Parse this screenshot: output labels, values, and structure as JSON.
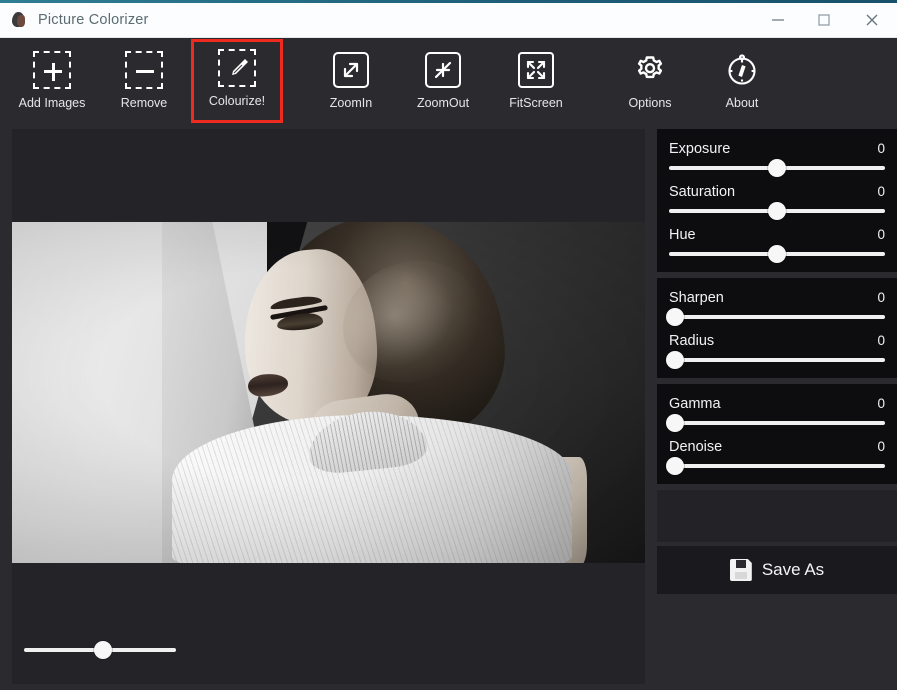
{
  "window": {
    "title": "Picture Colorizer",
    "icon": "app-logo-icon",
    "accent_top_color": "#2e7e95",
    "titlebar_bg": "#fbfdfe",
    "controls": {
      "minimize_label": "–",
      "maximize_label": "□",
      "close_label": "✕"
    }
  },
  "toolbar": {
    "background": "#2b2b2f",
    "highlight_color": "#ef2b20",
    "items": [
      {
        "label": "Add Images",
        "icon": "dashed-square-plus-icon",
        "highlighted": false
      },
      {
        "label": "Remove",
        "icon": "dashed-square-minus-icon",
        "highlighted": false
      },
      {
        "label": "Colourize!",
        "icon": "dashed-square-eyedropper-icon",
        "highlighted": true
      },
      {
        "label": "ZoomIn",
        "icon": "zoom-in-arrows-icon",
        "highlighted": false
      },
      {
        "label": "ZoomOut",
        "icon": "zoom-out-arrows-icon",
        "highlighted": false
      },
      {
        "label": "FitScreen",
        "icon": "fit-screen-arrows-icon",
        "highlighted": false
      },
      {
        "label": "Options",
        "icon": "gear-icon",
        "highlighted": false
      },
      {
        "label": "About",
        "icon": "compass-icon",
        "highlighted": false
      }
    ]
  },
  "canvas": {
    "background": "#242428",
    "image_description": "Black and white vintage portrait photograph of a woman in profile with a short bob hairstyle wearing a white ribbed sleeveless turtleneck top",
    "zoom_slider": {
      "name": "zoom-slider",
      "value_percent": 52
    }
  },
  "sidebar": {
    "background": "#2b2b2f",
    "group_background": "#0d0d10",
    "groups": [
      {
        "sliders": [
          {
            "label": "Exposure",
            "value": "0",
            "position_percent": 50
          },
          {
            "label": "Saturation",
            "value": "0",
            "position_percent": 50
          },
          {
            "label": "Hue",
            "value": "0",
            "position_percent": 50
          }
        ]
      },
      {
        "sliders": [
          {
            "label": "Sharpen",
            "value": "0",
            "position_percent": 2
          },
          {
            "label": "Radius",
            "value": "0",
            "position_percent": 2
          }
        ]
      },
      {
        "sliders": [
          {
            "label": "Gamma",
            "value": "0",
            "position_percent": 2
          },
          {
            "label": "Denoise",
            "value": "0",
            "position_percent": 2
          }
        ]
      }
    ],
    "save_button": {
      "label": "Save As",
      "icon": "floppy-disk-save-icon"
    }
  }
}
